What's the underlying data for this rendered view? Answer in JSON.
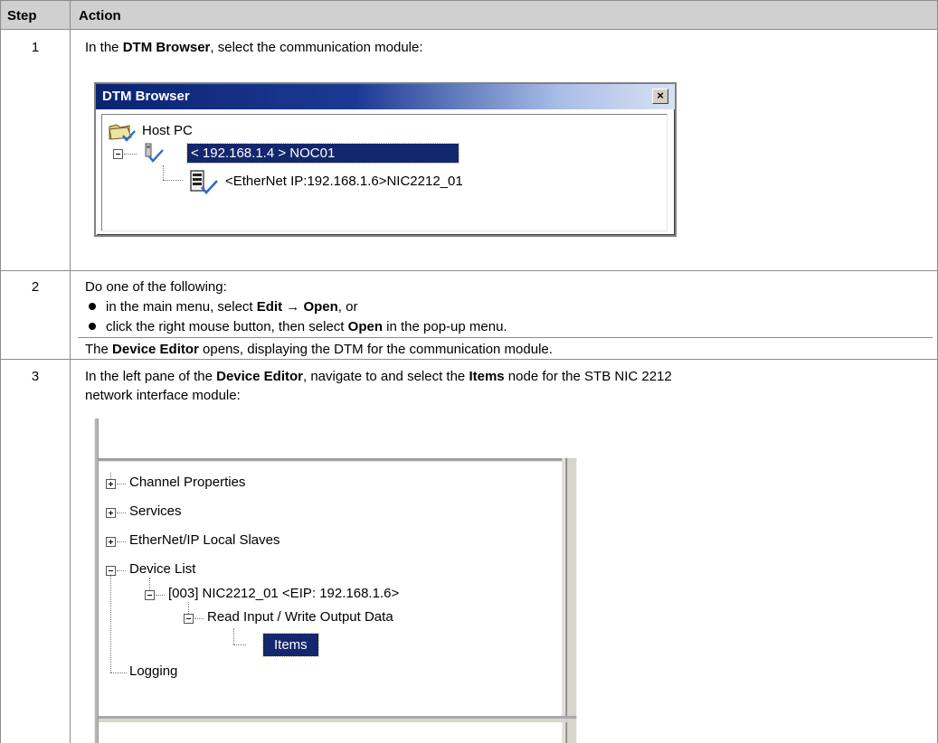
{
  "header": {
    "step": "Step",
    "action": "Action"
  },
  "steps": [
    {
      "number": "1",
      "text_pre": "In the ",
      "text_bold": "DTM Browser",
      "text_post": ", select the communication module:",
      "dtm_browser": {
        "title": "DTM Browser",
        "close_glyph": "×",
        "tree": {
          "root": "Host PC",
          "module": "< 192.168.1.4 > NOC01",
          "child": "<EtherNet IP:192.168.1.6>NIC2212_01"
        }
      }
    },
    {
      "number": "2",
      "intro": "Do one of the following:",
      "bullets": [
        {
          "pre": "in the main menu, select ",
          "b1": "Edit",
          "mid": " → ",
          "b2": "Open",
          "post": ", or"
        },
        {
          "pre": "click the right mouse button, then select ",
          "b1": "Open",
          "post": " in the pop-up menu."
        }
      ],
      "result_pre": "The ",
      "result_bold": "Device Editor",
      "result_post": " opens, displaying the DTM for the communication module."
    },
    {
      "number": "3",
      "line1_pre": "In the left pane of the ",
      "line1_b1": "Device Editor",
      "line1_mid": ", navigate to and select the ",
      "line1_b2": "Items",
      "line1_post": " node for the STB NIC 2212",
      "line2": "network interface module:",
      "tree": {
        "channel_properties": "Channel Properties",
        "services": "Services",
        "local_slaves": "EtherNet/IP Local Slaves",
        "device_list": "Device List",
        "device": "[003] NIC2212_01 <EIP: 192.168.1.6>",
        "read_write": "Read Input / Write Output Data",
        "items": "Items",
        "logging": "Logging"
      }
    }
  ]
}
